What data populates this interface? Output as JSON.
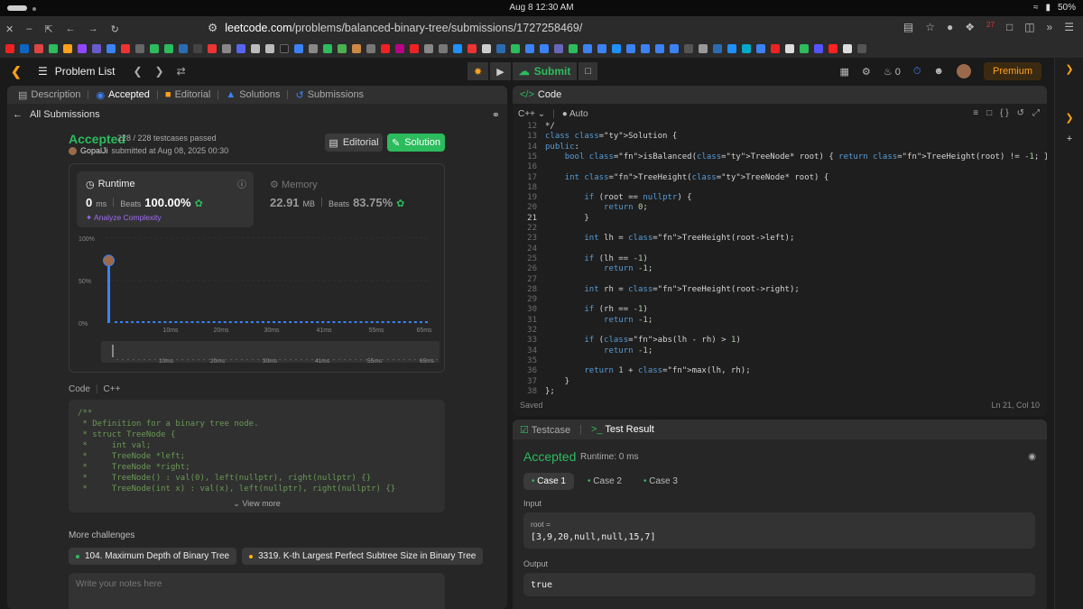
{
  "os": {
    "clock": "Aug 8  12:30 AM",
    "battery": "50%"
  },
  "browser": {
    "url_host": "leetcode.com",
    "url_path": "/problems/balanced-binary-tree/submissions/1727258469/",
    "ext_badge": "27"
  },
  "header": {
    "problem_list": "Problem List",
    "submit": "Submit",
    "fire_count": "0",
    "premium": "Premium"
  },
  "left": {
    "tabs": [
      {
        "label": "Description"
      },
      {
        "label": "Accepted"
      },
      {
        "label": "Editorial"
      },
      {
        "label": "Solutions"
      },
      {
        "label": "Submissions"
      }
    ],
    "all_submissions": "All Submissions",
    "status": "Accepted",
    "testcases": "228 / 228 testcases passed",
    "submitter": "GopalJi",
    "submitted_at": "submitted at Aug 08, 2025 00:30",
    "editorial_btn": "Editorial",
    "solution_btn": "Solution",
    "runtime_label": "Runtime",
    "runtime_value": "0",
    "runtime_unit": "ms",
    "beats_label": "Beats",
    "runtime_beats": "100.00%",
    "analyze": "Analyze Complexity",
    "memory_label": "Memory",
    "memory_value": "22.91",
    "memory_unit": "MB",
    "memory_beats": "83.75%",
    "code_label": "Code",
    "code_lang": "C++",
    "code_preview": "/**\n * Definition for a binary tree node.\n * struct TreeNode {\n *     int val;\n *     TreeNode *left;\n *     TreeNode *right;\n *     TreeNode() : val(0), left(nullptr), right(nullptr) {}\n *     TreeNode(int x) : val(x), left(nullptr), right(nullptr) {}",
    "view_more": "View more",
    "more_challenges": "More challenges",
    "challenges": [
      {
        "label": "104. Maximum Depth of Binary Tree",
        "color": "#2cbb5d"
      },
      {
        "label": "3319. K-th Largest Perfect Subtree Size in Binary Tree",
        "color": "#ffb800"
      }
    ],
    "notes_placeholder": "Write your notes here"
  },
  "chart_data": {
    "type": "bar",
    "y_ticks": [
      "100%",
      "50%",
      "0%"
    ],
    "x_ticks": [
      "10ms",
      "20ms",
      "30ms",
      "41ms",
      "55ms",
      "65ms"
    ],
    "ylim": [
      0,
      100
    ],
    "highlight_bar_value": 80,
    "range_ticks": [
      "10ms",
      "20ms",
      "30ms",
      "41ms",
      "55ms",
      "65ms"
    ]
  },
  "code": {
    "title": "Code",
    "lang": "C++",
    "mode": "Auto",
    "saved": "Saved",
    "cursor": "Ln 21, Col 10",
    "lines": [
      {
        "n": "12",
        "t": "*/"
      },
      {
        "n": "13",
        "t": "class Solution {"
      },
      {
        "n": "14",
        "t": "public:"
      },
      {
        "n": "15",
        "t": "    bool isBalanced(TreeNode* root) { return TreeHeight(root) != -1; }"
      },
      {
        "n": "16",
        "t": ""
      },
      {
        "n": "17",
        "t": "    int TreeHeight(TreeNode* root) {"
      },
      {
        "n": "18",
        "t": ""
      },
      {
        "n": "19",
        "t": "        if (root == nullptr) {"
      },
      {
        "n": "20",
        "t": "            return 0;"
      },
      {
        "n": "21",
        "t": "        }"
      },
      {
        "n": "22",
        "t": ""
      },
      {
        "n": "23",
        "t": "        int lh = TreeHeight(root->left);"
      },
      {
        "n": "24",
        "t": ""
      },
      {
        "n": "25",
        "t": "        if (lh == -1)"
      },
      {
        "n": "26",
        "t": "            return -1;"
      },
      {
        "n": "27",
        "t": ""
      },
      {
        "n": "28",
        "t": "        int rh = TreeHeight(root->right);"
      },
      {
        "n": "29",
        "t": ""
      },
      {
        "n": "30",
        "t": "        if (rh == -1)"
      },
      {
        "n": "31",
        "t": "            return -1;"
      },
      {
        "n": "32",
        "t": ""
      },
      {
        "n": "33",
        "t": "        if (abs(lh - rh) > 1)"
      },
      {
        "n": "34",
        "t": "            return -1;"
      },
      {
        "n": "35",
        "t": ""
      },
      {
        "n": "36",
        "t": "        return 1 + max(lh, rh);"
      },
      {
        "n": "37",
        "t": "    }"
      },
      {
        "n": "38",
        "t": "};"
      }
    ]
  },
  "test": {
    "tab_testcase": "Testcase",
    "tab_result": "Test Result",
    "status": "Accepted",
    "runtime": "Runtime: 0 ms",
    "cases": [
      "Case 1",
      "Case 2",
      "Case 3"
    ],
    "input_label": "Input",
    "input_var": "root =",
    "input_value": "[3,9,20,null,null,15,7]",
    "output_label": "Output",
    "output_value": "true"
  }
}
